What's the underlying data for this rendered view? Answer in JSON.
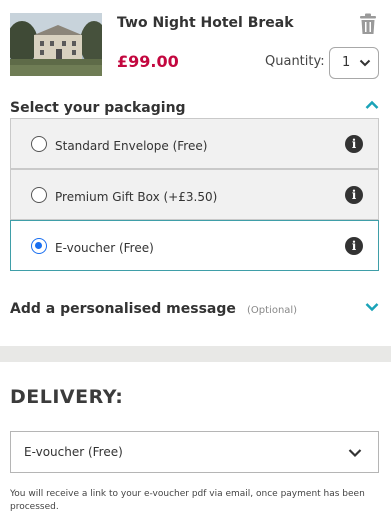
{
  "product": {
    "title": "Two Night Hotel Break",
    "price": "£99.00",
    "quantity_label": "Quantity:",
    "quantity_value": "1",
    "image_icon": "hotel-photo"
  },
  "packaging": {
    "title": "Select your packaging",
    "options": [
      {
        "label": "Standard Envelope (Free)",
        "selected": false
      },
      {
        "label": "Premium Gift Box (+£3.50)",
        "selected": false
      },
      {
        "label": "E-voucher (Free)",
        "selected": true
      }
    ],
    "info_glyph": "i"
  },
  "message": {
    "title": "Add a personalised message",
    "optional": "(Optional)"
  },
  "delivery": {
    "title": "DELIVERY:",
    "selected": "E-voucher (Free)",
    "note": "You will receive a link to your e-voucher pdf via email, once payment has been processed."
  },
  "colors": {
    "price": "#c3073f",
    "accent_teal": "#1aa3b8",
    "selected_border": "#3f9ea8",
    "radio_selected": "#1a6ff0"
  }
}
